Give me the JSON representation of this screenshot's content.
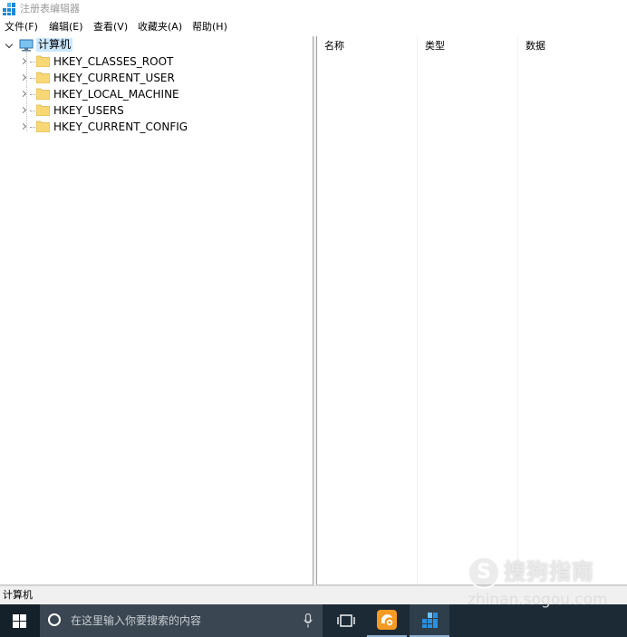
{
  "window": {
    "title": "注册表编辑器"
  },
  "menu": {
    "items": [
      "文件(F)",
      "编辑(E)",
      "查看(V)",
      "收藏夹(A)",
      "帮助(H)"
    ]
  },
  "tree": {
    "root_label": "计算机",
    "root_expanded": true,
    "items": [
      {
        "label": "HKEY_CLASSES_ROOT"
      },
      {
        "label": "HKEY_CURRENT_USER"
      },
      {
        "label": "HKEY_LOCAL_MACHINE"
      },
      {
        "label": "HKEY_USERS"
      },
      {
        "label": "HKEY_CURRENT_CONFIG"
      }
    ]
  },
  "list": {
    "columns": [
      "名称",
      "类型",
      "数据"
    ]
  },
  "status": {
    "path": "计算机"
  },
  "taskbar": {
    "search_placeholder": "在这里输入你要搜索的内容",
    "apps": [
      "uc-browser",
      "registry-editor"
    ]
  },
  "watermark": {
    "brand": "搜狗指南",
    "url": "zhinan.sogou.com"
  },
  "colors": {
    "selection": "#cce8ff",
    "taskbar": "#1c2a36",
    "folder": "#f8d775"
  }
}
